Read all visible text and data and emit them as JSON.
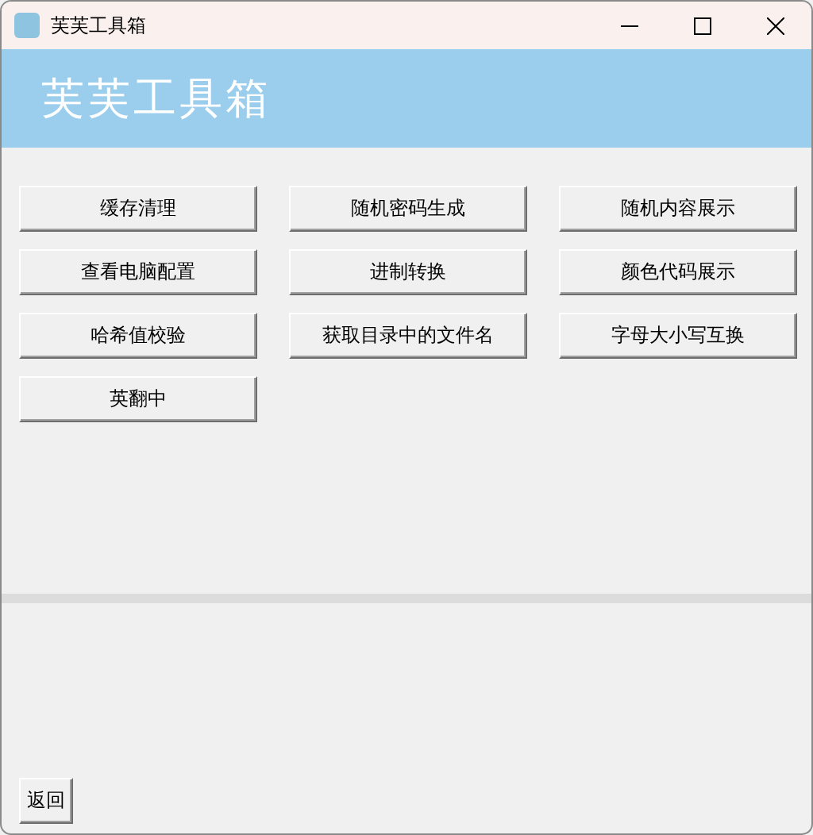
{
  "window": {
    "title": "芙芙工具箱"
  },
  "banner": {
    "title": "芙芙工具箱"
  },
  "tools": [
    "缓存清理",
    "随机密码生成",
    "随机内容展示",
    "查看电脑配置",
    "进制转换",
    "颜色代码展示",
    "哈希值校验",
    "获取目录中的文件名",
    "字母大小写互换",
    "英翻中"
  ],
  "back_button": "返回"
}
